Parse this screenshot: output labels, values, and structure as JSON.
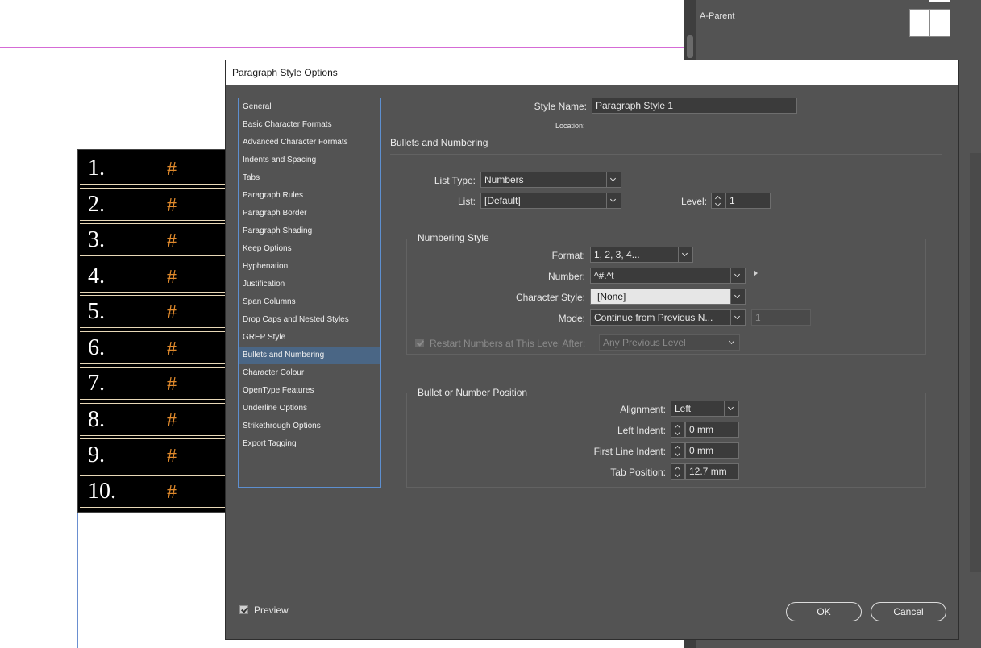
{
  "document": {
    "list_numbers": [
      "1.",
      "2.",
      "3.",
      "4.",
      "5.",
      "6.",
      "7.",
      "8.",
      "9.",
      "10."
    ],
    "list_marker": "#",
    "marker_color": "#e08a2c"
  },
  "pages_panel": {
    "parent_label": "A-Parent"
  },
  "dialog": {
    "title": "Paragraph Style Options",
    "categories": [
      "General",
      "Basic Character Formats",
      "Advanced Character Formats",
      "Indents and Spacing",
      "Tabs",
      "Paragraph Rules",
      "Paragraph Border",
      "Paragraph Shading",
      "Keep Options",
      "Hyphenation",
      "Justification",
      "Span Columns",
      "Drop Caps and Nested Styles",
      "GREP Style",
      "Bullets and Numbering",
      "Character Colour",
      "OpenType Features",
      "Underline Options",
      "Strikethrough Options",
      "Export Tagging"
    ],
    "selected_category": "Bullets and Numbering",
    "style_name_label": "Style Name:",
    "style_name_value": "Paragraph Style 1",
    "location_label": "Location:",
    "section_title": "Bullets and Numbering",
    "list_type_label": "List Type:",
    "list_type_value": "Numbers",
    "list_label": "List:",
    "list_value": "[Default]",
    "level_label": "Level:",
    "level_value": "1",
    "numbering_style": {
      "title": "Numbering Style",
      "format_label": "Format:",
      "format_value": "1, 2, 3, 4...",
      "number_label": "Number:",
      "number_value": "^#.^t",
      "char_style_label": "Character Style:",
      "char_style_value": "[None]",
      "mode_label": "Mode:",
      "mode_value": "Continue from Previous N...",
      "mode_start": "1",
      "restart_label": "Restart Numbers at This Level After:",
      "restart_value": "Any Previous Level"
    },
    "position": {
      "title": "Bullet or Number Position",
      "alignment_label": "Alignment:",
      "alignment_value": "Left",
      "left_indent_label": "Left Indent:",
      "left_indent_value": "0 mm",
      "first_line_label": "First Line Indent:",
      "first_line_value": "0 mm",
      "tab_position_label": "Tab Position:",
      "tab_position_value": "12.7 mm"
    },
    "preview_label": "Preview",
    "ok_label": "OK",
    "cancel_label": "Cancel"
  }
}
